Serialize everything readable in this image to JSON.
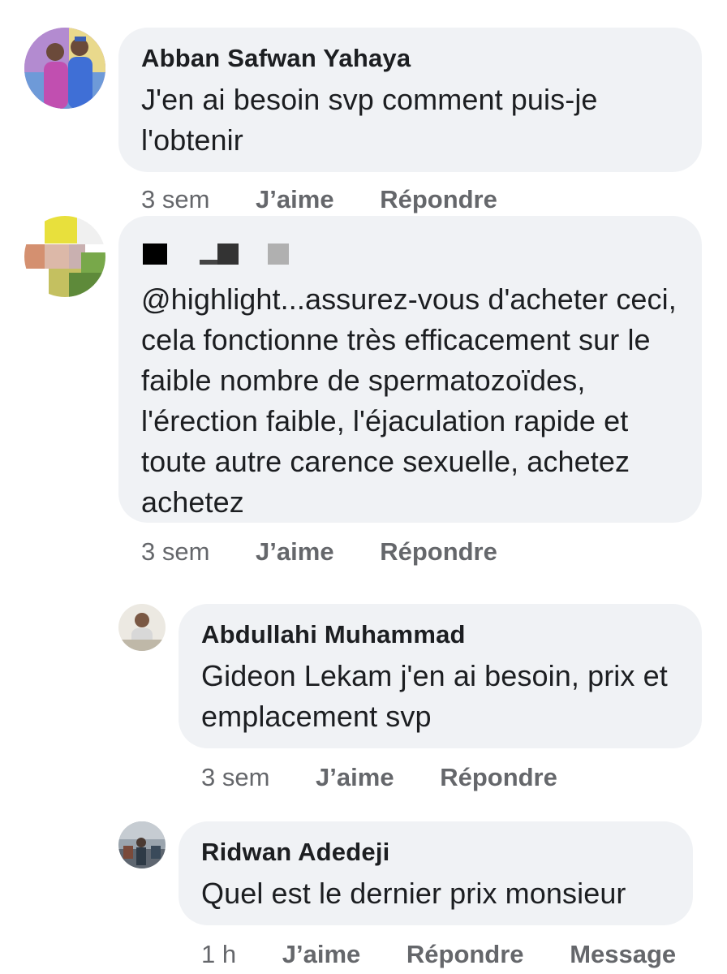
{
  "comments": [
    {
      "author": "Abban Safwan Yahaya",
      "text": "J'en ai besoin svp comment puis-je l'obtenir",
      "time": "3 sem",
      "like": "J’aime",
      "reply": "Répondre"
    },
    {
      "author": "",
      "text": "@highlight...assurez-vous d'acheter ceci, cela fonctionne très efficacement sur le faible nombre de spermatozoïdes, l'érection faible, l'éjaculation rapide et toute autre carence sexuelle, achetez achetez",
      "time": "3 sem",
      "like": "J’aime",
      "reply": "Répondre"
    }
  ],
  "replies": [
    {
      "author": "Abdullahi Muhammad",
      "text": "Gideon Lekam j'en ai besoin, prix et emplacement svp",
      "time": "3 sem",
      "like": "J’aime",
      "reply": "Répondre"
    },
    {
      "author": "Ridwan Adedeji",
      "text": "Quel est le dernier prix monsieur",
      "time": "1 h",
      "like": "J’aime",
      "reply": "Répondre",
      "message": "Message"
    }
  ],
  "colors": {
    "bubble": "#f0f2f5",
    "meta": "#65676b",
    "text": "#1c1e21"
  }
}
